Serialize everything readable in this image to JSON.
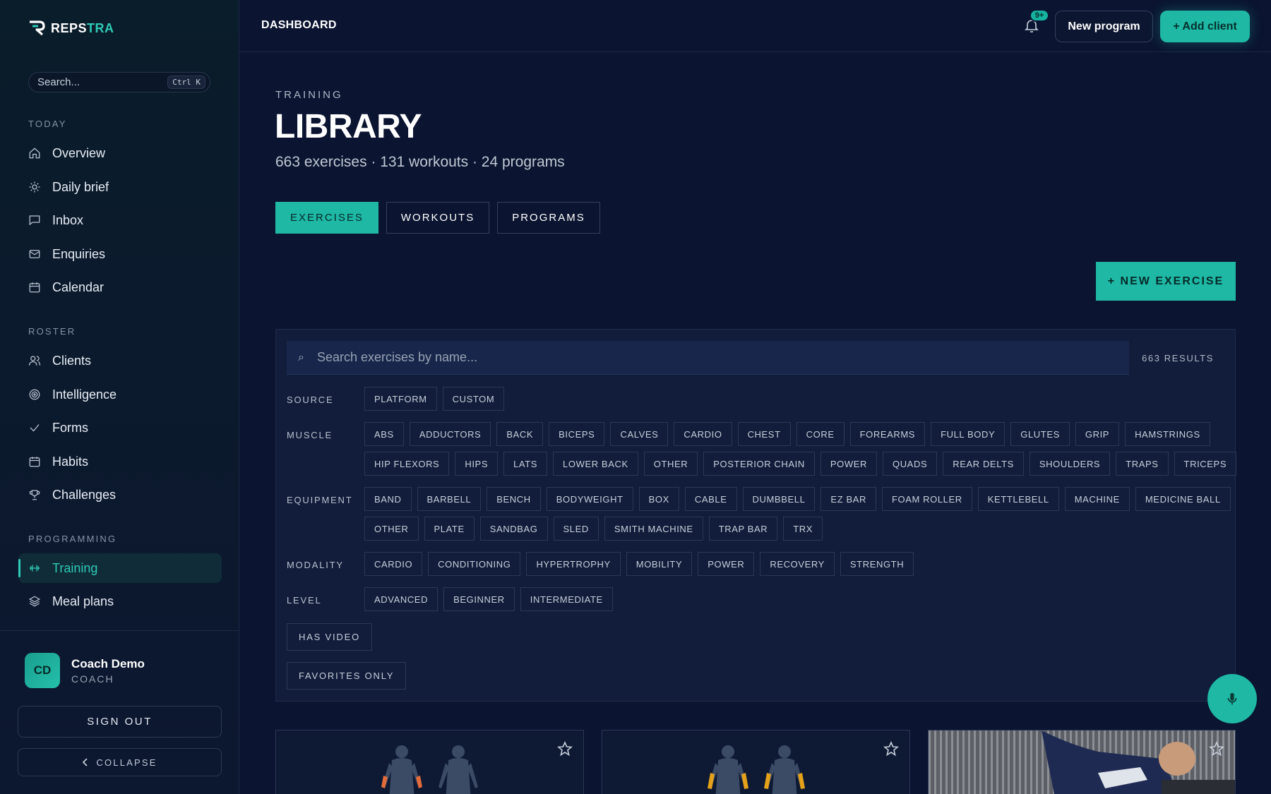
{
  "brand": {
    "name_a": "REPS",
    "name_b": "TRA"
  },
  "sidebar": {
    "search_placeholder": "Search...",
    "shortcut": "Ctrl K",
    "sections": {
      "today": "TODAY",
      "roster": "ROSTER",
      "programming": "PROGRAMMING"
    },
    "today": [
      {
        "label": "Overview",
        "icon": "home-icon"
      },
      {
        "label": "Daily brief",
        "icon": "sun-icon"
      },
      {
        "label": "Inbox",
        "icon": "message-icon"
      },
      {
        "label": "Enquiries",
        "icon": "mail-icon"
      },
      {
        "label": "Calendar",
        "icon": "calendar-icon"
      }
    ],
    "roster": [
      {
        "label": "Clients",
        "icon": "users-icon"
      },
      {
        "label": "Intelligence",
        "icon": "target-icon"
      },
      {
        "label": "Forms",
        "icon": "check-icon"
      },
      {
        "label": "Habits",
        "icon": "calendar-icon"
      },
      {
        "label": "Challenges",
        "icon": "trophy-icon"
      }
    ],
    "programming": [
      {
        "label": "Training",
        "icon": "dumbbell-icon",
        "active": true
      },
      {
        "label": "Meal plans",
        "icon": "layers-icon"
      }
    ],
    "user": {
      "initials": "CD",
      "name": "Coach Demo",
      "role": "COACH"
    },
    "sign_out": "SIGN OUT",
    "collapse": "COLLAPSE"
  },
  "header": {
    "breadcrumb": "DASHBOARD",
    "notification_badge": "9+",
    "new_program": "New program",
    "add_client": "+ Add client"
  },
  "main": {
    "eyebrow": "TRAINING",
    "title": "LIBRARY",
    "subtitle": "663 exercises · 131 workouts · 24 programs",
    "tabs": [
      {
        "label": "EXERCISES",
        "active": true
      },
      {
        "label": "WORKOUTS"
      },
      {
        "label": "PROGRAMS"
      }
    ],
    "new_exercise": "+ NEW EXERCISE",
    "search_placeholder": "Search exercises by name...",
    "results": "663 RESULTS",
    "filters": {
      "source": {
        "label": "SOURCE",
        "chips": [
          "PLATFORM",
          "CUSTOM"
        ]
      },
      "muscle": {
        "label": "MUSCLE",
        "row1": [
          "ABS",
          "ADDUCTORS",
          "BACK",
          "BICEPS",
          "CALVES",
          "CARDIO",
          "CHEST",
          "CORE",
          "FOREARMS",
          "FULL BODY",
          "GLUTES",
          "GRIP",
          "HAMSTRINGS"
        ],
        "row2": [
          "HIP FLEXORS",
          "HIPS",
          "LATS",
          "LOWER BACK",
          "OTHER",
          "POSTERIOR CHAIN",
          "POWER",
          "QUADS",
          "REAR DELTS",
          "SHOULDERS",
          "TRAPS",
          "TRICEPS"
        ]
      },
      "equipment": {
        "label": "EQUIPMENT",
        "row1": [
          "BAND",
          "BARBELL",
          "BENCH",
          "BODYWEIGHT",
          "BOX",
          "CABLE",
          "DUMBBELL",
          "EZ BAR",
          "FOAM ROLLER",
          "KETTLEBELL",
          "MACHINE",
          "MEDICINE BALL"
        ],
        "row2": [
          "OTHER",
          "PLATE",
          "SANDBAG",
          "SLED",
          "SMITH MACHINE",
          "TRAP BAR",
          "TRX"
        ]
      },
      "modality": {
        "label": "MODALITY",
        "chips": [
          "CARDIO",
          "CONDITIONING",
          "HYPERTROPHY",
          "MOBILITY",
          "POWER",
          "RECOVERY",
          "STRENGTH"
        ]
      },
      "level": {
        "label": "LEVEL",
        "chips": [
          "ADVANCED",
          "BEGINNER",
          "INTERMEDIATE"
        ]
      },
      "has_video": "HAS VIDEO",
      "favorites_only": "FAVORITES ONLY"
    }
  },
  "colors": {
    "accent": "#1eb8a5",
    "background": "#0b1430",
    "panel": "#111d3a"
  }
}
